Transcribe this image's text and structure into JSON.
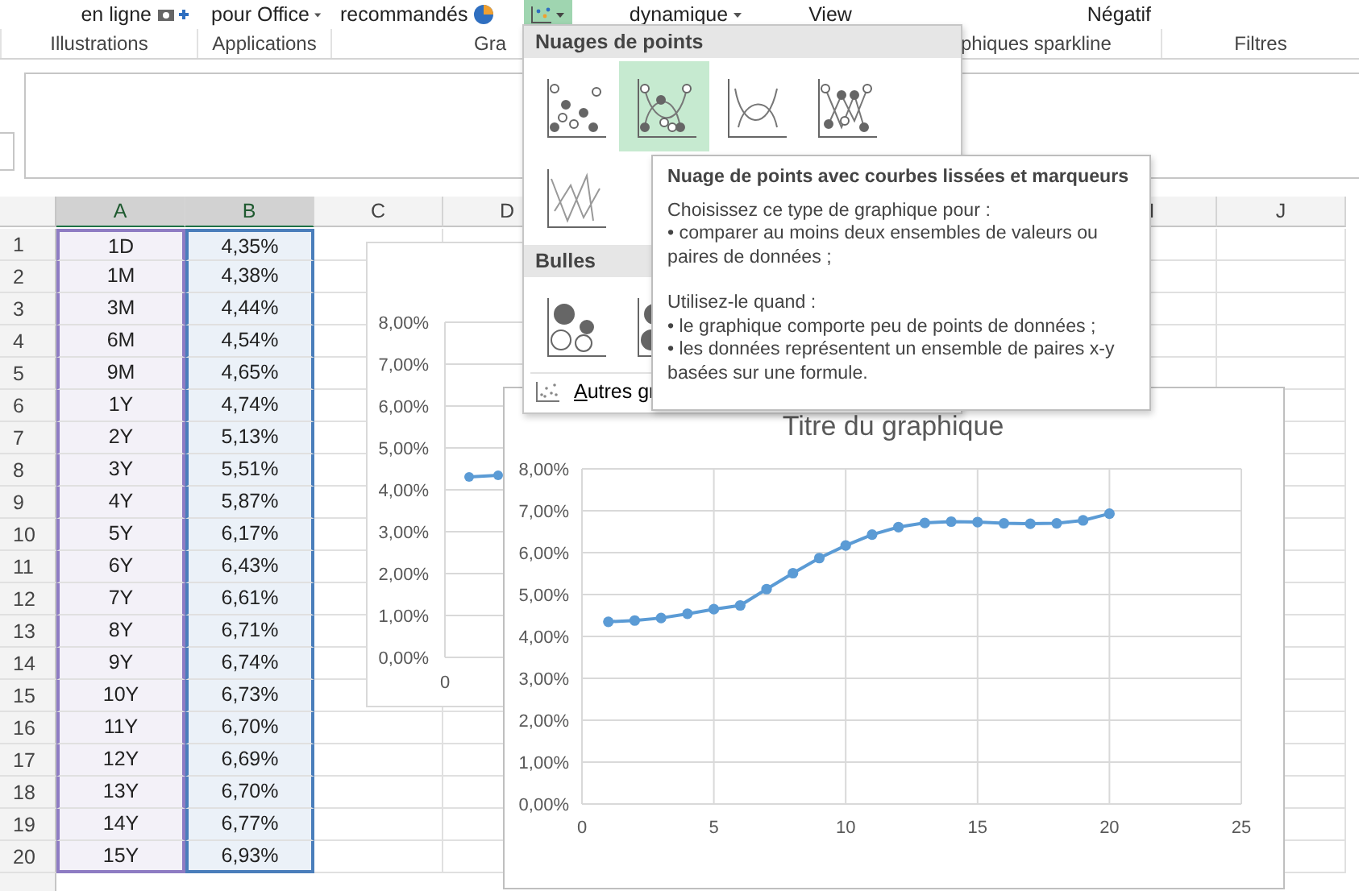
{
  "ribbon": {
    "commands": [
      {
        "label": "en ligne",
        "kind": "camera"
      },
      {
        "label": "pour Office",
        "kind": "caret"
      },
      {
        "label": "recommandés",
        "kind": "pie"
      },
      {
        "kind": "scatter",
        "selected": true
      },
      {
        "label": "dynamique",
        "kind": "caret"
      },
      {
        "label": "View",
        "kind": "plain"
      },
      {
        "label": "Négatif",
        "kind": "plain"
      }
    ],
    "groups": [
      "Illustrations",
      "Applications",
      "Gra",
      "phiques sparkline",
      "Filtres"
    ]
  },
  "sheet": {
    "columns": [
      {
        "label": "A",
        "selected": true,
        "color": "#8e7cc3",
        "shaded": true
      },
      {
        "label": "B",
        "selected": true,
        "color": "#4a7ebb",
        "shaded": true
      },
      {
        "label": "C",
        "selected": false
      },
      {
        "label": "D",
        "selected": false
      },
      null,
      null,
      null,
      null,
      {
        "label": "I",
        "selected": false
      },
      {
        "label": "J",
        "selected": false
      }
    ],
    "rows": [
      {
        "number": "1",
        "a": "1D",
        "b": "4,35%"
      },
      {
        "number": "2",
        "a": "1M",
        "b": "4,38%"
      },
      {
        "number": "3",
        "a": "3M",
        "b": "4,44%"
      },
      {
        "number": "4",
        "a": "6M",
        "b": "4,54%"
      },
      {
        "number": "5",
        "a": "9M",
        "b": "4,65%"
      },
      {
        "number": "6",
        "a": "1Y",
        "b": "4,74%"
      },
      {
        "number": "7",
        "a": "2Y",
        "b": "5,13%"
      },
      {
        "number": "8",
        "a": "3Y",
        "b": "5,51%"
      },
      {
        "number": "9",
        "a": "4Y",
        "b": "5,87%"
      },
      {
        "number": "10",
        "a": "5Y",
        "b": "6,17%"
      },
      {
        "number": "11",
        "a": "6Y",
        "b": "6,43%"
      },
      {
        "number": "12",
        "a": "7Y",
        "b": "6,61%"
      },
      {
        "number": "13",
        "a": "8Y",
        "b": "6,71%"
      },
      {
        "number": "14",
        "a": "9Y",
        "b": "6,74%"
      },
      {
        "number": "15",
        "a": "10Y",
        "b": "6,73%"
      },
      {
        "number": "16",
        "a": "11Y",
        "b": "6,70%"
      },
      {
        "number": "17",
        "a": "12Y",
        "b": "6,69%"
      },
      {
        "number": "18",
        "a": "13Y",
        "b": "6,70%"
      },
      {
        "number": "19",
        "a": "14Y",
        "b": "6,77%"
      },
      {
        "number": "20",
        "a": "15Y",
        "b": "6,93%"
      }
    ]
  },
  "back_chart": {
    "y_labels": [
      "8,00%",
      "7,00%",
      "6,00%",
      "5,00%",
      "4,00%",
      "3,00%",
      "2,00%",
      "1,00%",
      "0,00%"
    ],
    "x_label": "0"
  },
  "chart": {
    "title": "Titre du graphique",
    "chart_data": {
      "type": "line",
      "grid": true,
      "x": [
        1,
        2,
        3,
        4,
        5,
        6,
        7,
        8,
        9,
        10,
        11,
        12,
        13,
        14,
        15,
        16,
        17,
        18,
        19,
        20
      ],
      "series": [
        {
          "color": "#5b9bd5",
          "marker": "circle",
          "values": [
            0.0435,
            0.0438,
            0.0444,
            0.0454,
            0.0465,
            0.0474,
            0.0513,
            0.0551,
            0.0587,
            0.0617,
            0.0643,
            0.0661,
            0.0671,
            0.0674,
            0.0673,
            0.067,
            0.0669,
            0.067,
            0.0677,
            0.0693
          ]
        }
      ],
      "xlim": [
        0,
        25
      ],
      "ylim": [
        0,
        0.08
      ],
      "xticks": [
        0,
        5,
        10,
        15,
        20,
        25
      ],
      "yticks": [
        {
          "value": 0,
          "label": "0,00%"
        },
        {
          "value": 0.01,
          "label": "1,00%"
        },
        {
          "value": 0.02,
          "label": "2,00%"
        },
        {
          "value": 0.03,
          "label": "3,00%"
        },
        {
          "value": 0.04,
          "label": "4,00%"
        },
        {
          "value": 0.05,
          "label": "5,00%"
        },
        {
          "value": 0.06,
          "label": "6,00%"
        },
        {
          "value": 0.07,
          "label": "7,00%"
        },
        {
          "value": 0.08,
          "label": "8,00%"
        }
      ]
    }
  },
  "chart_menu": {
    "sections": [
      {
        "title": "Nuages de points",
        "options": [
          {
            "kind": "markers",
            "selected": false
          },
          {
            "kind": "smooth-markers",
            "selected": true
          },
          {
            "kind": "smooth-lines",
            "selected": false
          },
          {
            "kind": "straight-markers",
            "selected": false
          },
          {
            "kind": "straight-lines",
            "selected": false
          }
        ]
      },
      {
        "title": "Bulles",
        "options": [
          {
            "kind": "bubble",
            "selected": false
          },
          {
            "kind": "bubble-3d",
            "selected": false
          }
        ]
      }
    ],
    "more_label": "Autres gr"
  },
  "tooltip": {
    "title": "Nuage de points avec courbes lissées et marqueurs",
    "paragraphs": [
      [
        "Choisissez ce type de graphique pour :",
        "• comparer au moins deux ensembles de valeurs ou paires de données ;"
      ],
      [
        "Utilisez-le quand :",
        "• le graphique comporte peu de points de données ;",
        "• les données représentent un ensemble de paires x-y basées sur une formule."
      ]
    ]
  }
}
